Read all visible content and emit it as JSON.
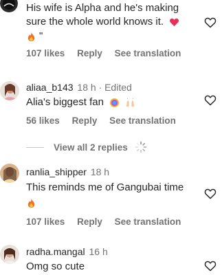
{
  "comments": [
    {
      "username": "",
      "time": "",
      "text_line1": "His wife is Alpha and he's making",
      "text_line2": "sure the whole world knows it.",
      "text_line2_suffix": "\"",
      "likes": "107 likes",
      "reply": "Reply",
      "translate": "See translation"
    },
    {
      "username": "aliaa_b143",
      "time": "18 h · Edited",
      "text": "Alia's biggest fan",
      "likes": "56 likes",
      "reply": "Reply",
      "translate": "See translation"
    },
    {
      "username": "ranlia_shipper",
      "time": "18 h",
      "text": "This reminds me of Gangubai time",
      "likes": "107 likes",
      "reply": "Reply",
      "translate": "See translation"
    },
    {
      "username": "radha.mangal",
      "time": "16 h",
      "text": "Omg so cute"
    }
  ],
  "view_replies": "View all 2 replies",
  "icons": {
    "like": "heart-outline-icon",
    "loading": "spinner-icon"
  },
  "colors": {
    "text": "#262626",
    "secondary": "#737373",
    "heart_emoji": "#e8305b",
    "fire_outer": "#f2711c",
    "fire_inner": "#ffc83d"
  }
}
